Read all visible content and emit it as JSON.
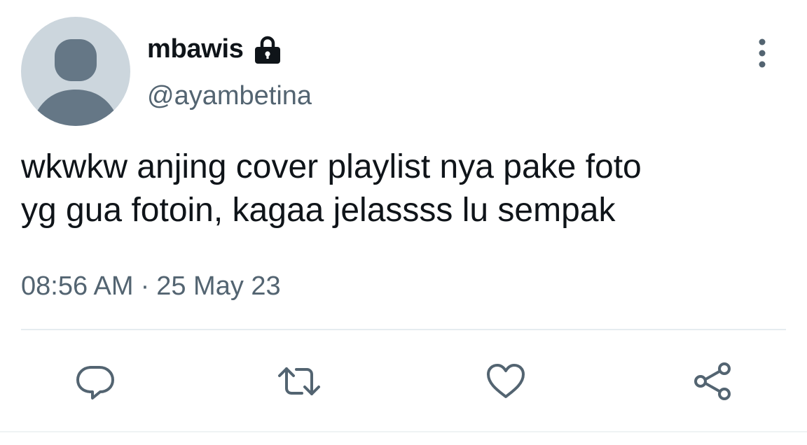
{
  "tweet": {
    "author": {
      "display_name": "mbawis",
      "handle": "@ayambetina",
      "avatar_icon": "default-avatar-icon",
      "protected_icon": "lock-icon"
    },
    "text": "wkwkw anjing cover playlist nya pake foto\nyg gua fotoin, kagaa jelassss lu sempak",
    "time": "08:56 AM",
    "separator": "·",
    "date": "25 May 23"
  },
  "actions": {
    "reply_icon": "reply-icon",
    "retweet_icon": "retweet-icon",
    "like_icon": "heart-icon",
    "share_icon": "share-icon",
    "more_icon": "more-vertical-icon"
  },
  "colors": {
    "text_primary": "#0f1419",
    "text_secondary": "#536471",
    "avatar_bg": "#ccd6dd",
    "avatar_fg": "#657786",
    "divider": "#e6ecf0"
  }
}
